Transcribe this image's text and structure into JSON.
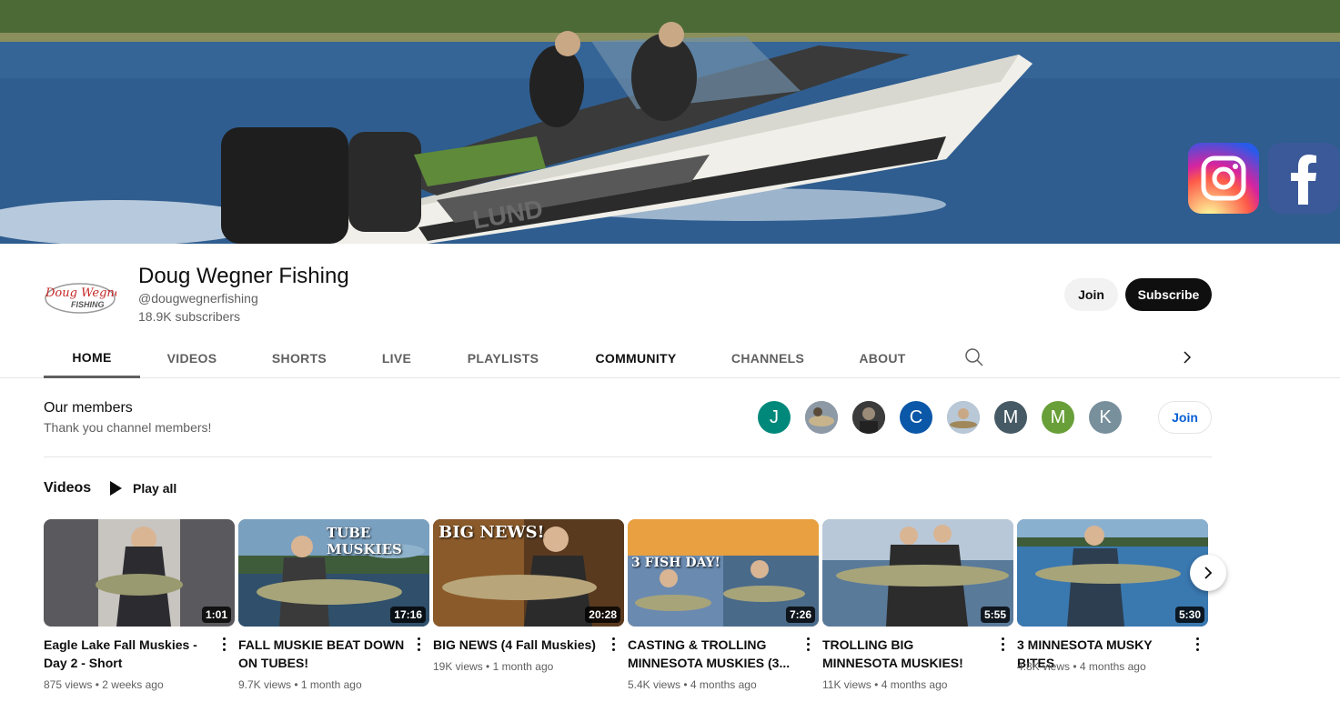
{
  "banner": {
    "boat_brand": "LUND",
    "social_icons": [
      "instagram-icon",
      "facebook-icon"
    ]
  },
  "channel": {
    "name": "Doug Wegner Fishing",
    "handle": "@dougwegnerfishing",
    "subscribers": "18.9K subscribers",
    "logo_text": "Doug Wegner FISHING"
  },
  "buttons": {
    "join": "Join",
    "subscribe": "Subscribe"
  },
  "tabs": [
    {
      "label": "HOME",
      "active": true
    },
    {
      "label": "VIDEOS"
    },
    {
      "label": "SHORTS"
    },
    {
      "label": "LIVE"
    },
    {
      "label": "PLAYLISTS"
    },
    {
      "label": "COMMUNITY"
    },
    {
      "label": "CHANNELS"
    },
    {
      "label": "ABOUT"
    }
  ],
  "members": {
    "title": "Our members",
    "subtitle": "Thank you channel members!",
    "join_label": "Join",
    "avatars": [
      {
        "letter": "J",
        "color": "#00897b"
      },
      {
        "letter": "",
        "color": "#7c8794"
      },
      {
        "letter": "",
        "color": "#4a4a4a"
      },
      {
        "letter": "C",
        "color": "#0b57a8"
      },
      {
        "letter": "",
        "color": "#8aa0b8"
      },
      {
        "letter": "M",
        "color": "#455a64"
      },
      {
        "letter": "M",
        "color": "#689f38"
      },
      {
        "letter": "K",
        "color": "#78909c"
      }
    ]
  },
  "videos": {
    "title": "Videos",
    "play_all": "Play all",
    "items": [
      {
        "title": "Eagle Lake Fall Muskies - Day 2 - Short",
        "views": "875 views",
        "age": "2 weeks ago",
        "duration": "1:01",
        "overlay": ""
      },
      {
        "title": "FALL MUSKIE BEAT DOWN ON TUBES!",
        "views": "9.7K views",
        "age": "1 month ago",
        "duration": "17:16",
        "overlay": "TUBE MUSKIES"
      },
      {
        "title": "BIG NEWS (4 Fall Muskies)",
        "views": "19K views",
        "age": "1 month ago",
        "duration": "20:28",
        "overlay": "BIG NEWS!"
      },
      {
        "title": "CASTING & TROLLING MINNESOTA MUSKIES (3...",
        "views": "5.4K views",
        "age": "4 months ago",
        "duration": "7:26",
        "overlay": "3 FISH DAY!"
      },
      {
        "title": "TROLLING BIG MINNESOTA MUSKIES!",
        "views": "11K views",
        "age": "4 months ago",
        "duration": "5:55",
        "overlay": ""
      },
      {
        "title": "3 MINNESOTA MUSKY BITES",
        "views": "4.8K views",
        "age": "4 months ago",
        "duration": "5:30",
        "overlay": ""
      }
    ]
  },
  "separator": "•"
}
